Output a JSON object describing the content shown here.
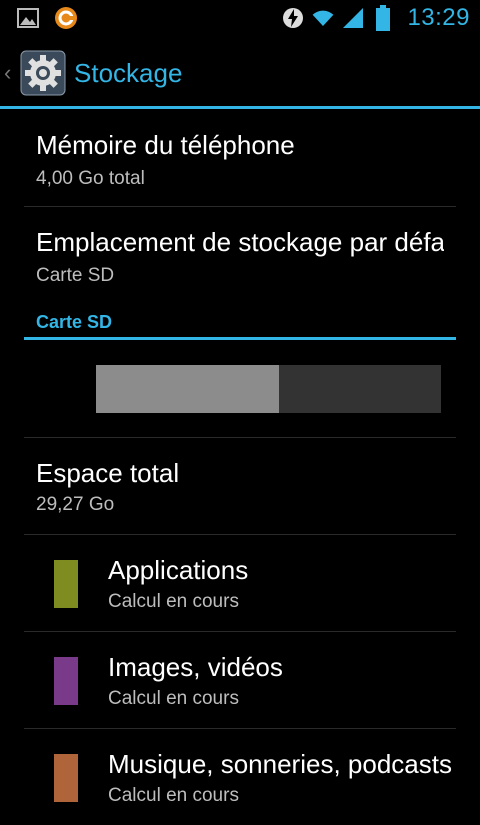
{
  "status_bar": {
    "time": "13:29",
    "icons": [
      "gallery-notification-icon",
      "sync-notification-icon",
      "charging-bolt-icon",
      "wifi-icon",
      "signal-icon",
      "battery-icon"
    ]
  },
  "action_bar": {
    "title": "Stockage",
    "icon": "settings-gear-icon"
  },
  "storage": {
    "internal": {
      "title": "Mémoire du téléphone",
      "value": "4,00  Go total"
    },
    "default_location": {
      "title": "Emplacement de stockage par défaut",
      "value": "Carte SD"
    },
    "section_title": "Carte SD",
    "usage_fraction": 0.53,
    "total": {
      "title": "Espace total",
      "value": "29,27 Go"
    },
    "categories": [
      {
        "title": "Applications",
        "status": "Calcul en cours",
        "color": "#7f8c1f"
      },
      {
        "title": "Images, vidéos",
        "status": "Calcul en cours",
        "color": "#7a3a8a"
      },
      {
        "title": "Musique, sonneries, podcasts",
        "status": "Calcul en cours",
        "color": "#b0643a"
      }
    ]
  },
  "colors": {
    "accent": "#33b5e5",
    "background": "#000000"
  }
}
